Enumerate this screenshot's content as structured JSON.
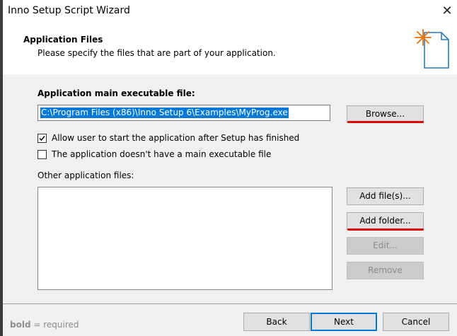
{
  "window": {
    "title": "Inno Setup Script Wizard",
    "close_glyph": "✕"
  },
  "header": {
    "title": "Application Files",
    "subtitle": "Please specify the files that are part of your application.",
    "icon": "wizard-document-sparkle-icon"
  },
  "main_exe": {
    "label": "Application main executable file:",
    "value": "C:\\Program Files (x86)\\Inno Setup 6\\Examples\\MyProg.exe",
    "browse_label": "Browse..."
  },
  "options": {
    "allow_start_label": "Allow user to start the application after Setup has finished",
    "allow_start_checked": true,
    "no_exe_label": "The application doesn't have a main executable file",
    "no_exe_checked": false
  },
  "other_files": {
    "label": "Other application files:",
    "items": [],
    "add_files_label": "Add file(s)...",
    "add_folder_label": "Add folder...",
    "edit_label": "Edit...",
    "remove_label": "Remove"
  },
  "footer": {
    "hint_bold": "bold",
    "hint_rest": " = required",
    "back_label": "Back",
    "next_label": "Next",
    "cancel_label": "Cancel"
  },
  "colors": {
    "accent": "#0078d7",
    "annotation_red": "#e00000",
    "icon_orange": "#e8730c",
    "icon_blue": "#2a7ab8"
  }
}
